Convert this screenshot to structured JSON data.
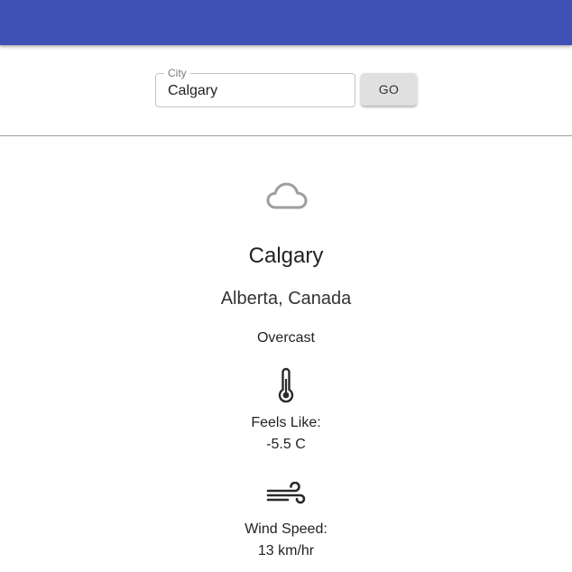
{
  "search": {
    "label": "City",
    "value": "Calgary",
    "button_label": "GO"
  },
  "weather": {
    "icon": "cloud-icon",
    "city": "Calgary",
    "region": "Alberta, Canada",
    "condition": "Overcast",
    "feels_like": {
      "icon": "thermometer-icon",
      "label": "Feels Like:",
      "value": "-5.5 C"
    },
    "wind": {
      "icon": "wind-icon",
      "label": "Wind Speed:",
      "value": "13 km/hr"
    }
  },
  "colors": {
    "app_bar": "#3f51b5",
    "button_bg": "#e0e0e0",
    "icon": "#2a2a2a",
    "cloud_icon": "#9e9e9e"
  }
}
